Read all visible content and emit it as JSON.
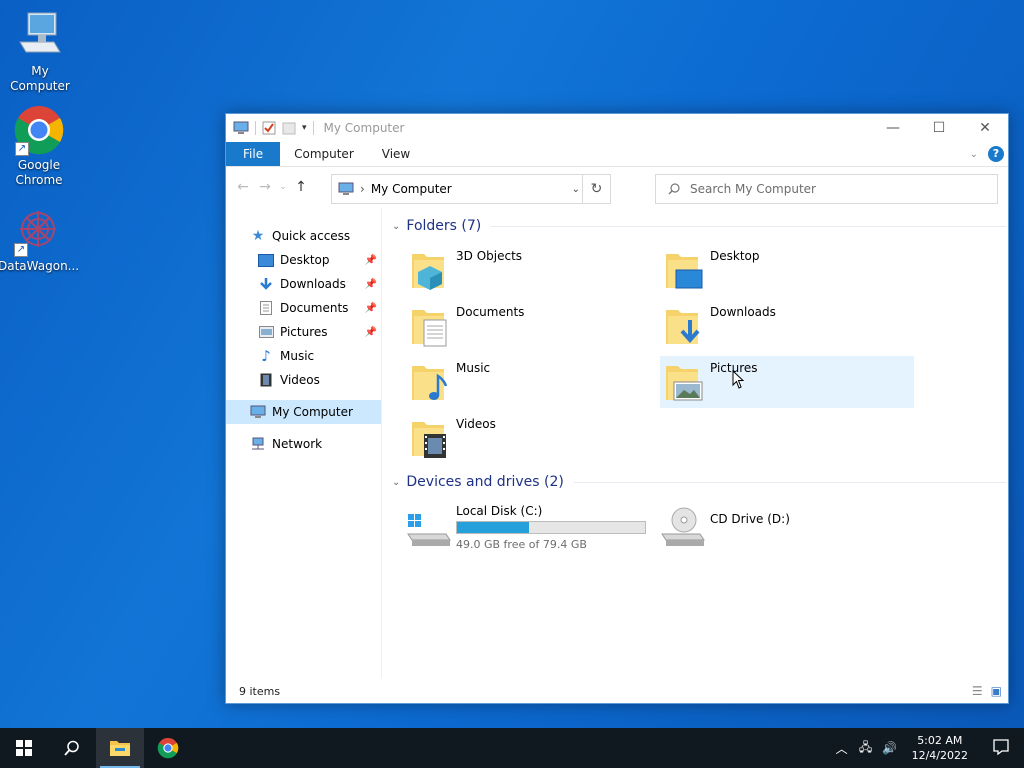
{
  "desktop": {
    "icons": [
      {
        "label": "My Computer",
        "icon": "computer-icon"
      },
      {
        "label": "Google Chrome",
        "icon": "chrome-icon"
      },
      {
        "label": "DataWagon...",
        "icon": "datawagon-icon"
      }
    ]
  },
  "window": {
    "title": "My Computer",
    "ribbon_tabs": [
      "File",
      "Computer",
      "View"
    ],
    "address": {
      "crumb": "My Computer"
    },
    "search": {
      "placeholder": "Search My Computer"
    },
    "nav": {
      "quick_access": "Quick access",
      "pinned": [
        {
          "label": "Desktop",
          "icon": "desktop-icon"
        },
        {
          "label": "Downloads",
          "icon": "downloads-icon"
        },
        {
          "label": "Documents",
          "icon": "documents-icon"
        },
        {
          "label": "Pictures",
          "icon": "pictures-icon"
        },
        {
          "label": "Music",
          "icon": "music-icon"
        },
        {
          "label": "Videos",
          "icon": "videos-icon"
        }
      ],
      "my_computer": "My Computer",
      "network": "Network"
    },
    "folders_header": "Folders (7)",
    "folders": [
      {
        "name": "3D Objects",
        "icon": "3d-objects-icon"
      },
      {
        "name": "Desktop",
        "icon": "desktop-folder-icon"
      },
      {
        "name": "Documents",
        "icon": "documents-folder-icon"
      },
      {
        "name": "Downloads",
        "icon": "downloads-folder-icon"
      },
      {
        "name": "Music",
        "icon": "music-folder-icon"
      },
      {
        "name": "Pictures",
        "icon": "pictures-folder-icon"
      },
      {
        "name": "Videos",
        "icon": "videos-folder-icon"
      }
    ],
    "drives_header": "Devices and drives (2)",
    "drives": [
      {
        "name": "Local Disk (C:)",
        "free": "49.0 GB free of 79.4 GB",
        "used_fraction": 0.383
      },
      {
        "name": "CD Drive (D:)"
      }
    ],
    "status": "9 items"
  },
  "taskbar": {
    "time": "5:02 AM",
    "date": "12/4/2022"
  },
  "colors": {
    "accent": "#1979ca",
    "selection": "#cce8ff",
    "drive_bar": "#26a0da",
    "taskbar": "#101820"
  }
}
